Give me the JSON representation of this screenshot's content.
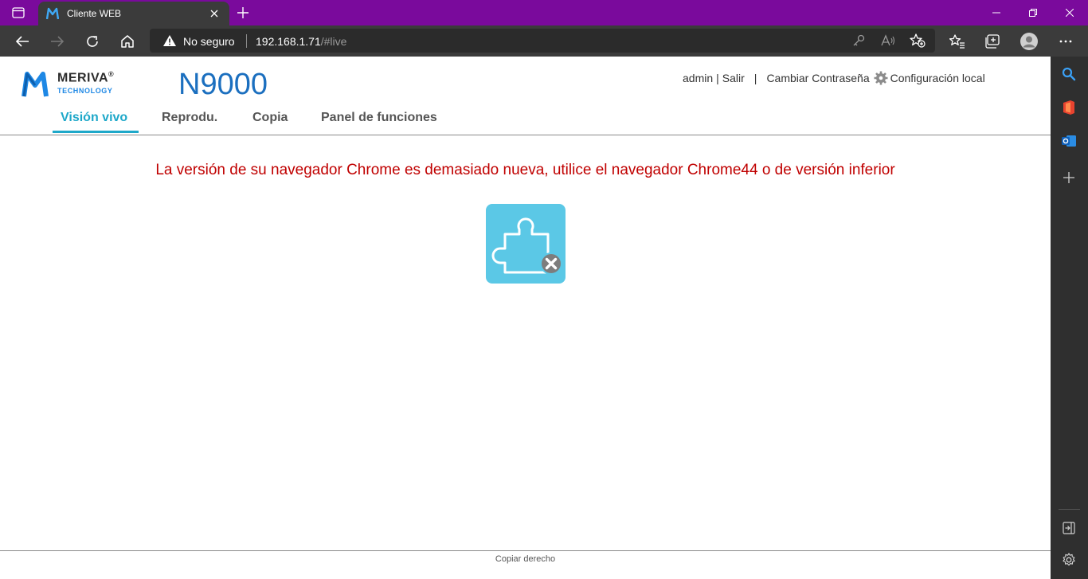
{
  "browser": {
    "tab_title": "Cliente WEB",
    "security_label": "No seguro",
    "url_host": "192.168.1.71",
    "url_path": "/#live"
  },
  "app": {
    "brand_name": "MERIVA",
    "brand_reg": "®",
    "brand_sub": "TECHNOLOGY",
    "model": "N9000",
    "user": "admin",
    "logout": "Salir",
    "change_password": "Cambiar Contraseña",
    "local_config": "Configuración local",
    "nav": [
      {
        "label": "Visión vivo",
        "active": true
      },
      {
        "label": "Reprodu.",
        "active": false
      },
      {
        "label": "Copia",
        "active": false
      },
      {
        "label": "Panel de funciones",
        "active": false
      }
    ],
    "warning": "La versión de su navegador Chrome es demasiado nueva, utilice el navegador Chrome44 o de versión inferior",
    "footer": "Copiar derecho"
  },
  "colors": {
    "titlebar": "#7a0a9c",
    "accent": "#1ea8c9",
    "warning": "#c00000",
    "model": "#1b6fbf",
    "plugin_bg": "#5bc8e6"
  }
}
